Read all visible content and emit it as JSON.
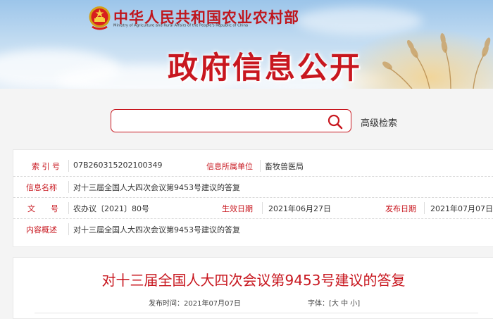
{
  "header": {
    "ministry_cn": "中华人民共和国农业农村部",
    "ministry_en": "Ministry of Agriculture and Rural Affairs of the People's Republic of China",
    "page_title": "政府信息公开",
    "emblem_icon": "national-emblem-icon"
  },
  "search": {
    "placeholder": "",
    "value": "",
    "icon": "search-icon",
    "advanced_label": "高级检索"
  },
  "info": {
    "index_label": "索 引 号",
    "index_value": "07B260315202100349",
    "dept_label": "信息所属单位",
    "dept_value": "畜牧兽医局",
    "name_label": "信息名称",
    "name_value": "对十三届全国人大四次会议第9453号建议的答复",
    "doc_label": "文　　号",
    "doc_value": "农办议〔2021〕80号",
    "effective_label": "生效日期",
    "effective_value": "2021年06月27日",
    "publish_label": "发布日期",
    "publish_value": "2021年07月07日",
    "summary_label": "内容概述",
    "summary_value": "对十三届全国人大四次会议第9453号建议的答复"
  },
  "article": {
    "title": "对十三届全国人大四次会议第9453号建议的答复",
    "publish_time": "发布时间：2021年07月07日",
    "font_label": "字体：[",
    "font_large": "大",
    "font_medium": "中",
    "font_small": "小",
    "font_end": "]"
  },
  "colors": {
    "accent_red": "#c8171f",
    "sky_blue": "#9cc5ea",
    "page_bg": "#f4f4f4"
  }
}
